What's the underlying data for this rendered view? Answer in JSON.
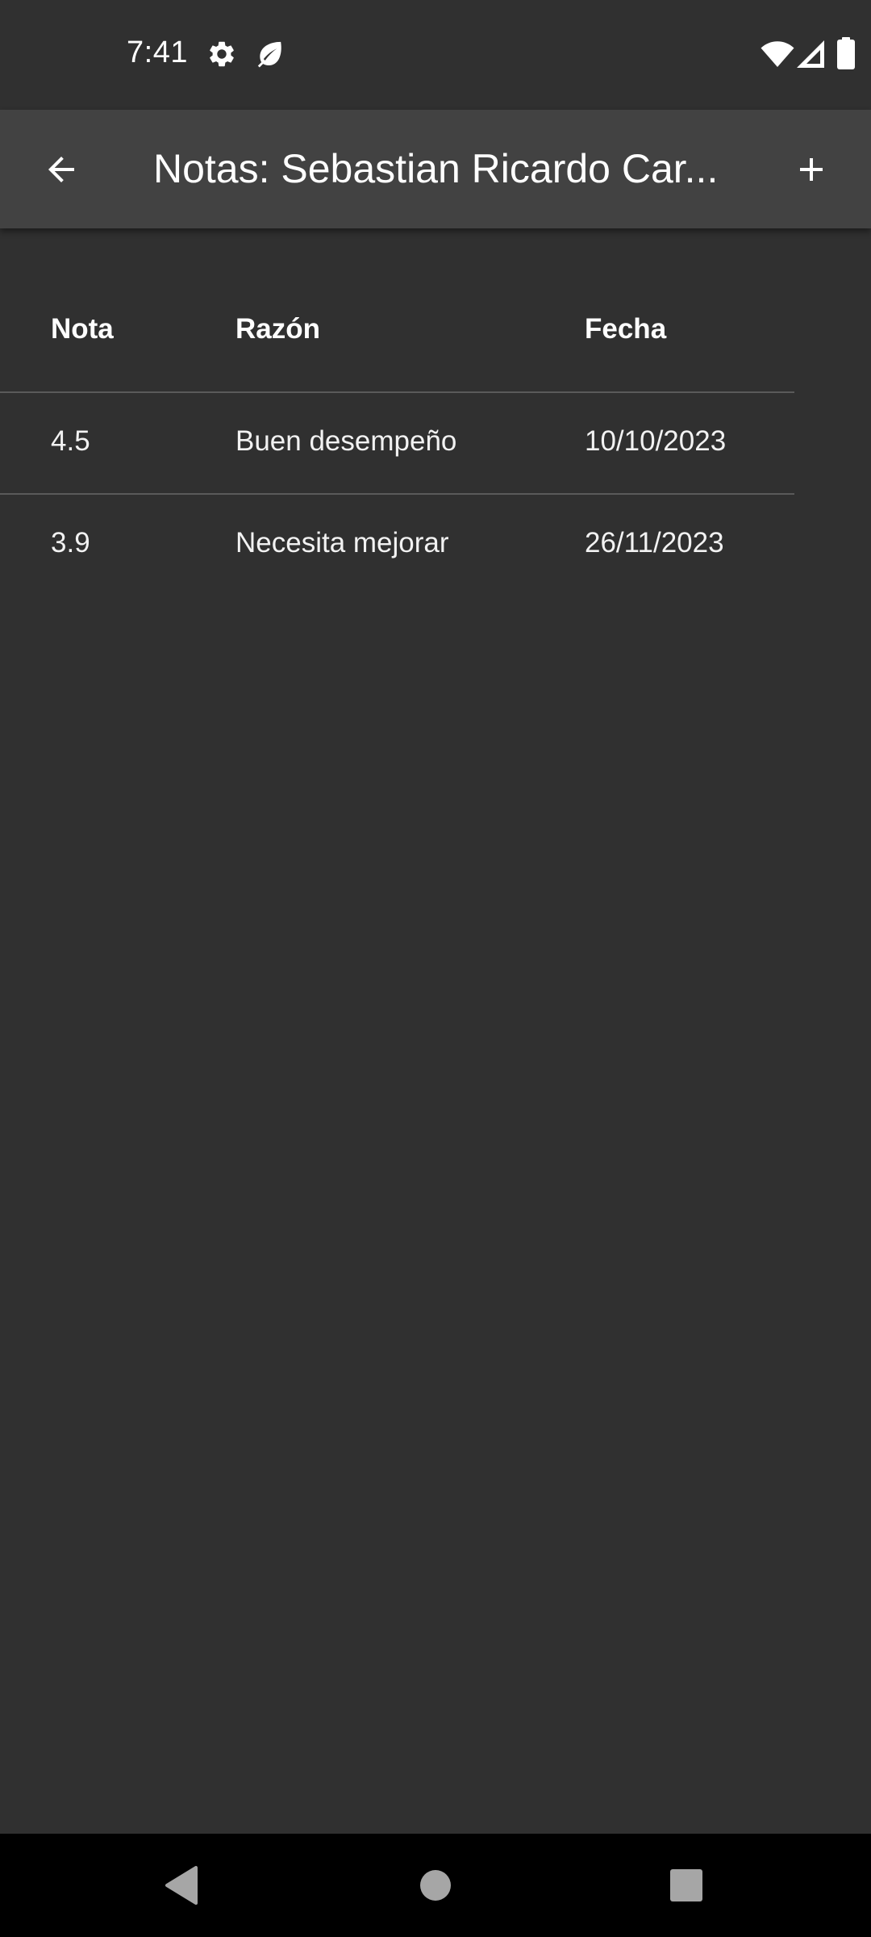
{
  "status_bar": {
    "time": "7:41",
    "icons": [
      "settings-gear-icon",
      "leaf-icon",
      "wifi-icon",
      "cellular-signal-icon",
      "battery-icon"
    ]
  },
  "app_bar": {
    "title": "Notas: Sebastian Ricardo Car...",
    "back_icon": "arrow-back-icon",
    "add_icon": "plus-icon"
  },
  "table": {
    "headers": [
      "Nota",
      "Razón",
      "Fecha"
    ],
    "rows": [
      {
        "nota": "4.5",
        "razon": "Buen desempeño",
        "fecha": "10/10/2023"
      },
      {
        "nota": "3.9",
        "razon": "Necesita mejorar",
        "fecha": "26/11/2023"
      }
    ]
  },
  "nav_bar": {
    "icons": [
      "back-triangle-icon",
      "home-circle-icon",
      "recents-square-icon"
    ]
  },
  "colors": {
    "background": "#303030",
    "app_bar": "#424242",
    "divider": "#5a5a5a",
    "nav_bar": "#000000",
    "text": "#ffffff",
    "nav_icons": "#a6a6a6"
  }
}
